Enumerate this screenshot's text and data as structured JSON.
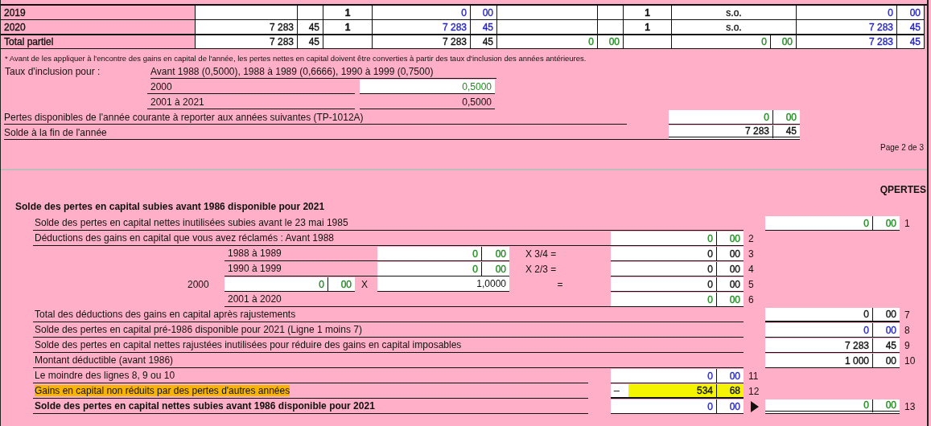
{
  "top_table": {
    "rows": [
      {
        "kind": "year",
        "label": "2019",
        "cells": [
          {
            "kind": "blank_money"
          },
          {
            "kind": "count",
            "text": "1"
          },
          {
            "kind": "money",
            "dollars": "0",
            "cents": "00",
            "color": "#2323c4"
          },
          {
            "kind": "blank_money"
          },
          {
            "kind": "count",
            "text": "1"
          },
          {
            "kind": "note",
            "text": "s.o."
          },
          {
            "kind": "money",
            "dollars": "0",
            "cents": "00",
            "color": "#2323c4"
          }
        ]
      },
      {
        "kind": "year",
        "label": "2020",
        "cells": [
          {
            "kind": "money",
            "dollars": "7 283",
            "cents": "45",
            "color": "#111111"
          },
          {
            "kind": "count",
            "text": "1"
          },
          {
            "kind": "money",
            "dollars": "7 283",
            "cents": "45",
            "color": "#2323c4"
          },
          {
            "kind": "blank_money"
          },
          {
            "kind": "count",
            "text": "1"
          },
          {
            "kind": "note",
            "text": "s.o."
          },
          {
            "kind": "money",
            "dollars": "7 283",
            "cents": "45",
            "color": "#2323c4"
          }
        ]
      },
      {
        "kind": "total",
        "label": "Total partiel",
        "cells": [
          {
            "kind": "money",
            "dollars": "7 283",
            "cents": "45",
            "color": "#111111"
          },
          {
            "kind": "blank_count"
          },
          {
            "kind": "money",
            "dollars": "7 283",
            "cents": "45",
            "color": "#111111"
          },
          {
            "kind": "money",
            "dollars": "0",
            "cents": "00",
            "color": "#1f8a1f"
          },
          {
            "kind": "blank_count"
          },
          {
            "kind": "money",
            "dollars": "0",
            "cents": "00",
            "color": "#1f8a1f"
          },
          {
            "kind": "money",
            "dollars": "7 283",
            "cents": "45",
            "color": "#2323c4"
          }
        ]
      }
    ]
  },
  "footnote": "* Avant de les appliquer à l'encontre des gains en capital de l'année, les pertes nettes en capital doivent être converties à partir des taux d'inclusion des années antérieures.",
  "inclusion": {
    "label": "Taux d'inclusion pour :",
    "note": "Avant 1988 (0,5000), 1988 à 1989 (0,6666), 1990 à 1999 (0,7500)",
    "rates": [
      {
        "period": "2000",
        "value": "0,5000",
        "color": "#1f8a1f",
        "editable": true
      },
      {
        "period": "2001 à 2021",
        "value": "0,5000",
        "color": "#111111",
        "editable": false
      }
    ]
  },
  "carryforward": {
    "label": "Pertes disponibles de l'année courante à reporter aux années suivantes (TP-1012A)",
    "dollars": "0",
    "cents": "00",
    "color": "#1f8a1f"
  },
  "year_end": {
    "label": "Solde à la fin de l'année",
    "dollars": "7 283",
    "cents": "45",
    "color": "#111111",
    "double_rule": true
  },
  "page_number": "Page 2 de 3",
  "form_code": "QPERTES",
  "section_title": "Solde des pertes en capital subies avant 1986 disponible pour 2021",
  "lines": [
    {
      "kind": "line_right",
      "label": "Solde des pertes en capital nettes inutilisées subies avant le 23 mai 1985",
      "amount": {
        "dollars": "0",
        "cents": "00",
        "color": "#1f8a1f"
      },
      "number": "1"
    },
    {
      "kind": "line_middle",
      "label": "Déductions des gains en capital que vous avez réclamés : Avant 1988",
      "amount": {
        "dollars": "0",
        "cents": "00",
        "color": "#1f8a1f"
      },
      "number": "2"
    },
    {
      "kind": "factor",
      "period": "1988 à 1989",
      "base": {
        "dollars": "0",
        "cents": "00",
        "color": "#1f8a1f"
      },
      "operator": "X 3/4 =",
      "amount": {
        "dollars": "0",
        "cents": "00",
        "color": "#111111"
      },
      "number": "3"
    },
    {
      "kind": "factor",
      "period": "1990 à 1999",
      "base": {
        "dollars": "0",
        "cents": "00",
        "color": "#1f8a1f"
      },
      "operator": "X 2/3 =",
      "amount": {
        "dollars": "0",
        "cents": "00",
        "color": "#111111"
      },
      "number": "4"
    },
    {
      "kind": "rate",
      "period": "2000",
      "base": {
        "dollars": "0",
        "cents": "00",
        "color": "#1f8a1f"
      },
      "operator": "X",
      "rate": "1,0000",
      "equals": "=",
      "amount": {
        "dollars": "0",
        "cents": "00",
        "color": "#111111"
      },
      "number": "5"
    },
    {
      "kind": "sub",
      "period": "2001 à 2020",
      "amount": {
        "dollars": "0",
        "cents": "00",
        "color": "#1f8a1f"
      },
      "number": "6"
    },
    {
      "kind": "line_right",
      "label": "Total des déductions des gains en capital après rajustements",
      "amount": {
        "dollars": "0",
        "cents": "00",
        "color": "#111111",
        "total_rule": true
      },
      "number": "7"
    },
    {
      "kind": "line_right",
      "label": "Solde des pertes en capital pré-1986 disponible pour 2021 (Ligne 1 moins 7)",
      "amount": {
        "dollars": "0",
        "cents": "00",
        "color": "#2323c4"
      },
      "number": "8"
    },
    {
      "kind": "line_right",
      "label": "Solde des pertes en capital nettes rajustées inutilisées pour réduire des gains en capital imposables",
      "amount": {
        "dollars": "7 283",
        "cents": "45",
        "color": "#111111"
      },
      "number": "9"
    },
    {
      "kind": "line_right",
      "label": "Montant déductible (avant 1986)",
      "amount": {
        "dollars": "1 000",
        "cents": "00",
        "color": "#111111"
      },
      "number": "10"
    },
    {
      "kind": "line_middle",
      "label": "Le moindre des lignes 8, 9 ou 10",
      "amount": {
        "dollars": "0",
        "cents": "00",
        "color": "#2323c4"
      },
      "number": "11"
    },
    {
      "kind": "line_middle",
      "label": "Gains en capital non réduits par des pertes d'autres années",
      "highlight": true,
      "sign": "–",
      "amount": {
        "dollars": "534",
        "cents": "68",
        "color": "#111111",
        "total_rule": true
      },
      "number": "12"
    },
    {
      "kind": "line_middle",
      "bold": true,
      "label": "Solde des pertes en capital nettes subies avant 1986 disponible pour 2021",
      "amount": {
        "dollars": "0",
        "cents": "00",
        "color": "#2323c4"
      },
      "transfer": {
        "dollars": "0",
        "cents": "00",
        "color": "#1f8a1f",
        "double_rule": true
      },
      "number": "13"
    }
  ]
}
